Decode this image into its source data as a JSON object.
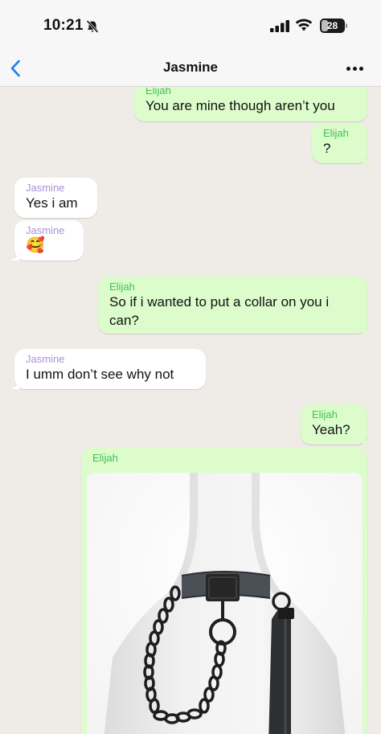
{
  "status": {
    "time": "10:21",
    "battery": "28",
    "battery_level": 0.28
  },
  "header": {
    "contact_name": "Jasmine"
  },
  "messages": [
    {
      "direction": "outgoing",
      "sender": "Elijah",
      "text": "You are mine though aren’t you"
    },
    {
      "direction": "outgoing",
      "sender": "Elijah",
      "text": "?"
    },
    {
      "direction": "incoming",
      "sender": "Jasmine",
      "text": "Yes i am"
    },
    {
      "direction": "incoming",
      "sender": "Jasmine",
      "text": "🥰"
    },
    {
      "direction": "outgoing",
      "sender": "Elijah",
      "text": "So if i wanted to put a collar on you i can?"
    },
    {
      "direction": "incoming",
      "sender": "Jasmine",
      "text": "I umm don’t see why not"
    },
    {
      "direction": "outgoing",
      "sender": "Elijah",
      "text": "Yeah?"
    },
    {
      "direction": "outgoing",
      "sender": "Elijah",
      "type": "image",
      "image": "collar-with-chain-leash-on-mannequin"
    }
  ],
  "colors": {
    "background": "#efebe6",
    "outgoing_bubble": "#dcfccc",
    "incoming_bubble": "#ffffff",
    "outgoing_sender": "#3fbf55",
    "incoming_sender": "#a891d7",
    "accent": "#1a7cf0"
  },
  "icons": [
    "chevron-left-icon",
    "more-dots-icon",
    "bell-slash-icon",
    "cellular-signal-icon",
    "wifi-icon",
    "battery-icon"
  ]
}
